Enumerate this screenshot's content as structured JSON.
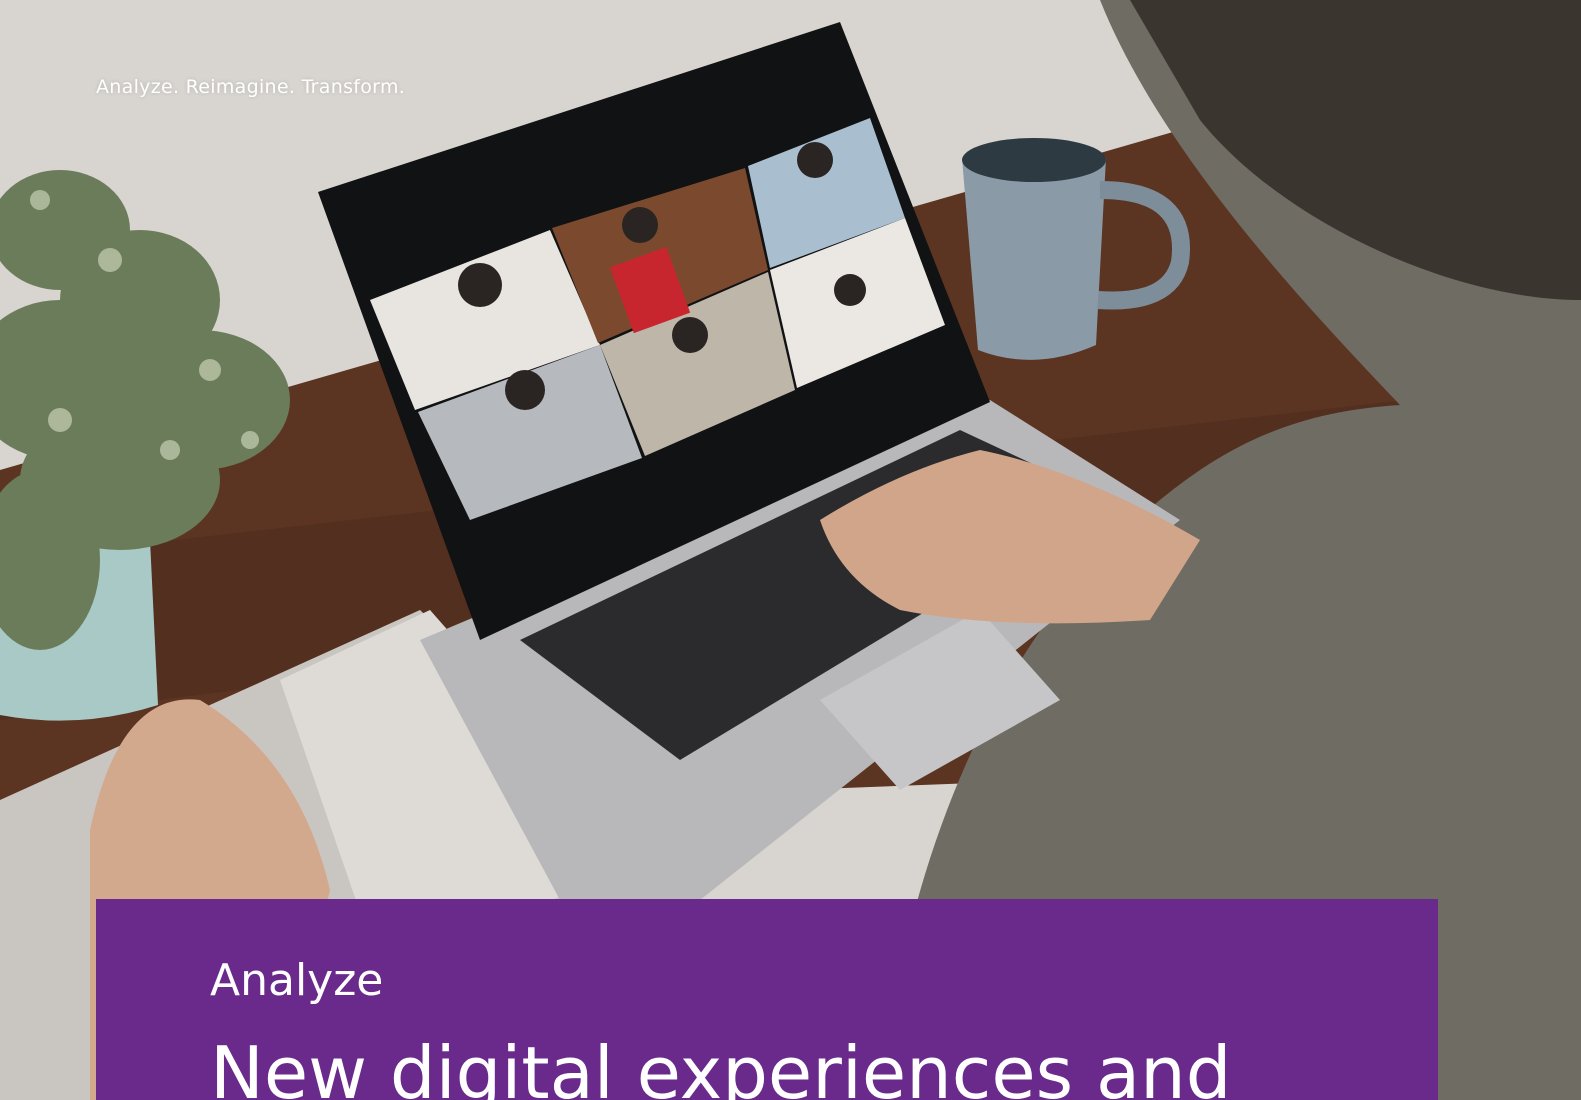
{
  "hero": {
    "tagline": "Analyze. Reimagine. Transform.",
    "image_subject": "person on laptop video call with plant and mug"
  },
  "panel": {
    "eyebrow": "Analyze",
    "title": "New digital experiences and",
    "background_color": "#6a2a8c"
  }
}
